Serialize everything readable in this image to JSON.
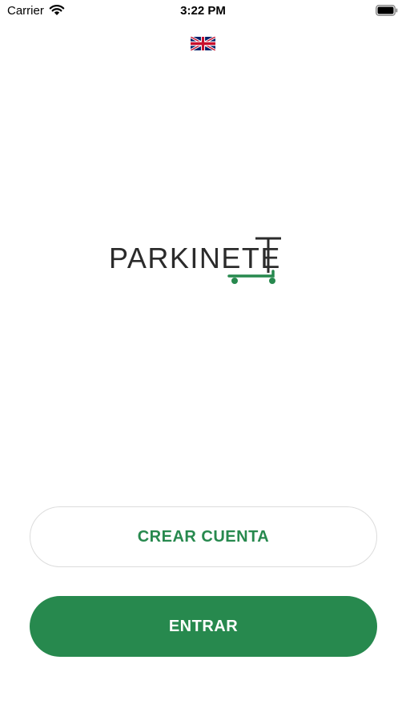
{
  "status_bar": {
    "carrier": "Carrier",
    "time": "3:22 PM",
    "wifi_icon": "wifi-icon",
    "battery_icon": "battery-icon"
  },
  "language": {
    "flag_icon": "uk-flag-icon"
  },
  "logo": {
    "text": "PARKINETE",
    "accent_color": "#27894e"
  },
  "actions": {
    "create_account_label": "CREAR CUENTA",
    "login_label": "ENTRAR"
  },
  "colors": {
    "brand_green": "#27894e"
  }
}
